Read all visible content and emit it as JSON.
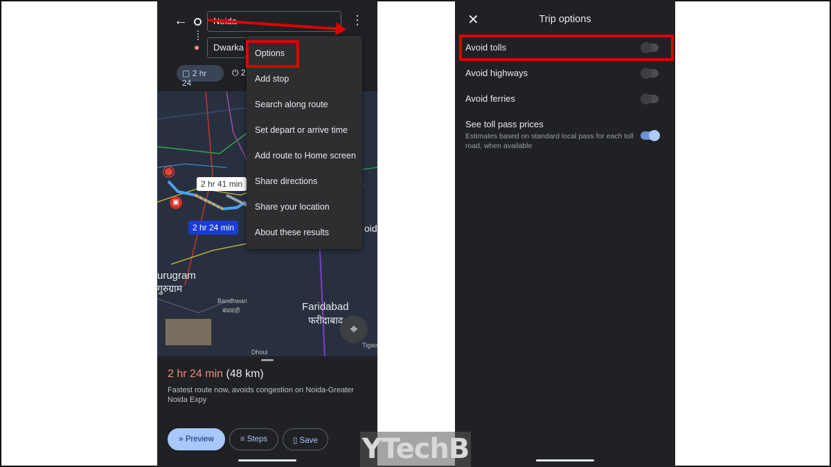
{
  "left_phone": {
    "origin_field": "Noida",
    "destination_field": "Dwarka",
    "mode_chip": "2 hr 24",
    "mode_chip_2": "2",
    "menu_items": [
      "Options",
      "Add stop",
      "Search along route",
      "Set depart or arrive time",
      "Add route to Home screen",
      "Share directions",
      "Share your location",
      "About these results"
    ],
    "map": {
      "bubble_alt": "2 hr 41 min",
      "bubble_main": "2 hr 24 min",
      "place_gurugram": "urugram",
      "place_gurugram_hi": "गुरुग्राम",
      "place_faridabad": "Faridabad",
      "place_faridabad_hi": "फरीदाबाद",
      "place_bandhwari": "Bandhwari",
      "place_bandhwari_hi": "बंधवाडी",
      "place_dhoui": "Dhoui",
      "place_noida_partial": "oida",
      "place_tigaon": "Tigao"
    },
    "summary": {
      "time": "2 hr 24 min",
      "distance": "(48 km)",
      "description": "Fastest route now, avoids congestion on Noida-Greater Noida Expy"
    },
    "buttons": {
      "preview": "Preview",
      "steps": "Steps",
      "save": "Save"
    }
  },
  "right_phone": {
    "title": "Trip options",
    "options": [
      {
        "label": "Avoid tolls",
        "on": false
      },
      {
        "label": "Avoid highways",
        "on": false
      },
      {
        "label": "Avoid ferries",
        "on": false
      },
      {
        "label": "See toll pass prices",
        "on": true
      }
    ],
    "toll_pass_subtext": "Estimates based on standard local pass for each toll road, when available"
  },
  "watermark": "YTechB",
  "colors": {
    "highlight": "#e00000",
    "accent": "#a8c7fa",
    "route_blue": "#1a3cd6",
    "time_red": "#f28b82"
  }
}
